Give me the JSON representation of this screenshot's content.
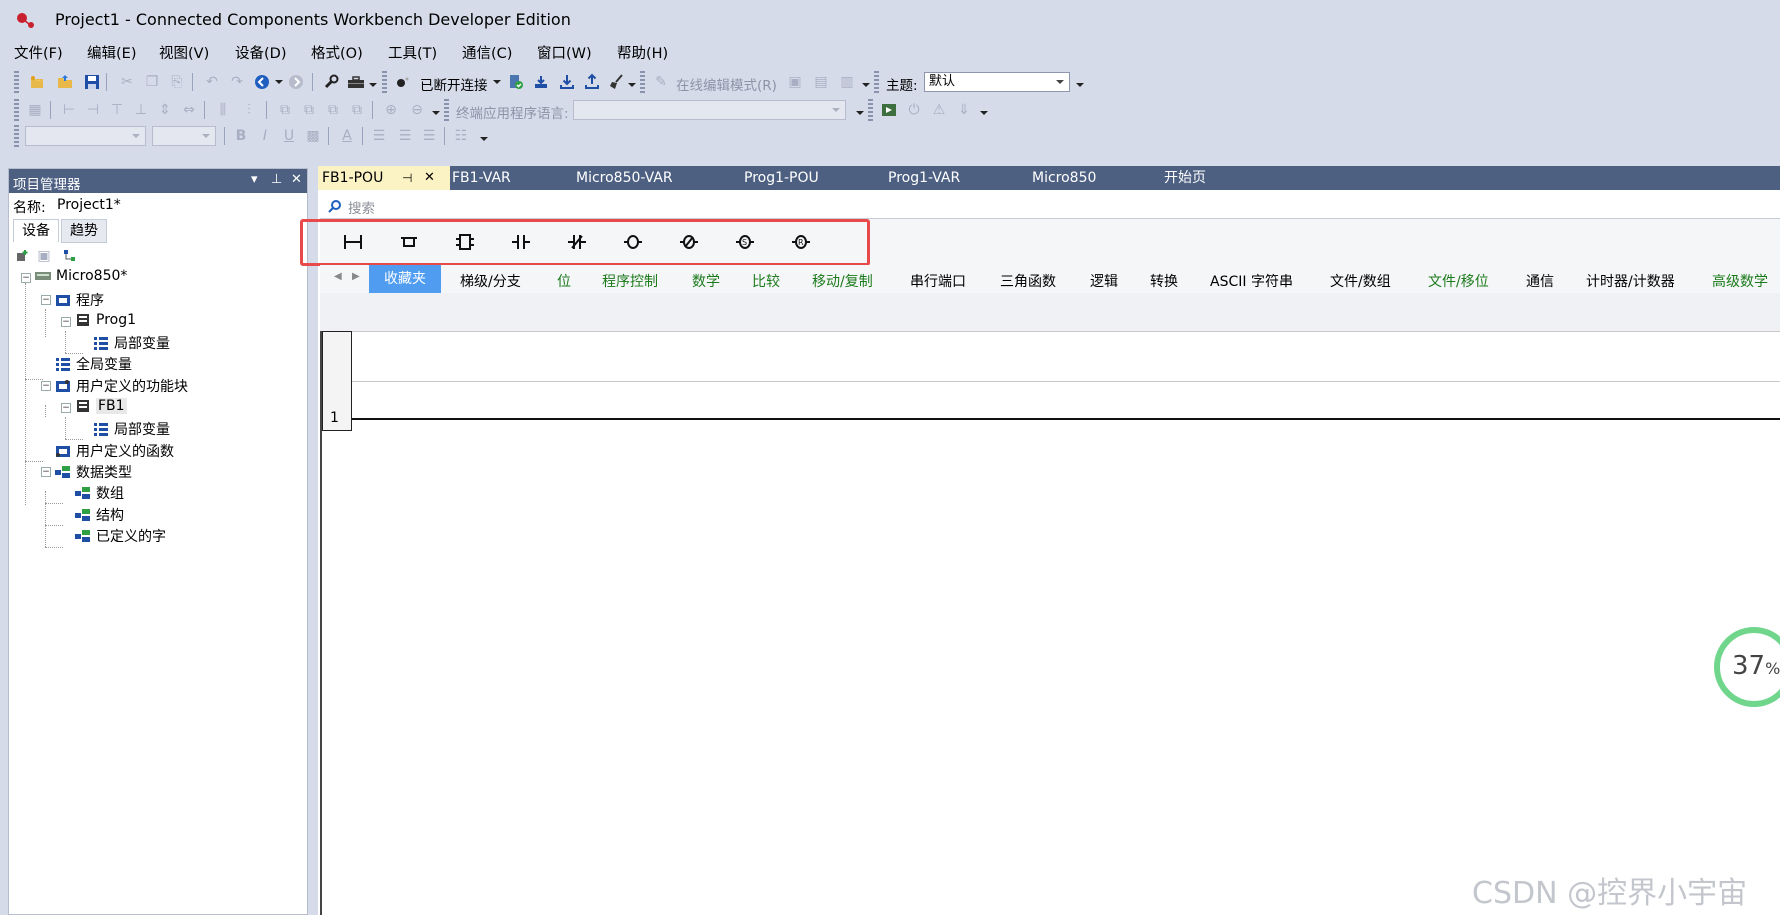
{
  "window": {
    "title": "Project1 - Connected Components Workbench Developer Edition"
  },
  "menu": [
    "文件(F)",
    "编辑(E)",
    "视图(V)",
    "设备(D)",
    "格式(O)",
    "工具(T)",
    "通信(C)",
    "窗口(W)",
    "帮助(H)"
  ],
  "toolbar1": {
    "connection_status": "已断开连接",
    "online_edit_mode": "在线编辑模式(R)",
    "theme_label": "主题:",
    "theme_value": "默认"
  },
  "toolbar2": {
    "terminal_language_label": "终端应用程序语言:",
    "terminal_language_value": ""
  },
  "toolbar3": {
    "font_value": "",
    "size_value": "",
    "bold": "B",
    "italic": "I",
    "underline": "U",
    "font_color": "A"
  },
  "project_manager": {
    "title": "项目管理器",
    "name_label": "名称:",
    "name_value": "Project1*",
    "tabs": [
      "设备",
      "趋势"
    ],
    "tree": {
      "root": "Micro850*",
      "program": "程序",
      "prog1": "Prog1",
      "prog1_local": "局部变量",
      "global_vars": "全局变量",
      "udfb": "用户定义的功能块",
      "fb1": "FB1",
      "fb1_local": "局部变量",
      "udf": "用户定义的函数",
      "datatypes": "数据类型",
      "arrays": "数组",
      "structs": "结构",
      "defined_strings": "已定义的字"
    }
  },
  "doc_tabs": [
    "FB1-POU",
    "FB1-VAR",
    "Micro850-VAR",
    "Prog1-POU",
    "Prog1-VAR",
    "Micro850",
    "开始页"
  ],
  "editor": {
    "search_placeholder": "搜索",
    "ladder_icons": [
      "rung-icon",
      "branch-icon",
      "block-icon",
      "contact-icon",
      "negated-contact-icon",
      "coil-icon",
      "negated-coil-icon",
      "set-coil-icon",
      "reset-coil-icon"
    ],
    "categories": [
      "收藏夹",
      "梯级/分支",
      "位",
      "程序控制",
      "数学",
      "比较",
      "移动/复制",
      "串行端口",
      "三角函数",
      "逻辑",
      "转换",
      "ASCII 字符串",
      "文件/数组",
      "文件/移位",
      "通信",
      "计时器/计数器",
      "高级数学"
    ],
    "rung_number": "1"
  },
  "overlay": {
    "progress": "37",
    "progress_unit": "%",
    "watermark": "CSDN @控界小宇宙"
  },
  "colors": {
    "panel_header": "#4d6082",
    "active_category": "#4f9cf0",
    "highlight": "#e8494a",
    "active_tab": "#fcf3c4"
  }
}
